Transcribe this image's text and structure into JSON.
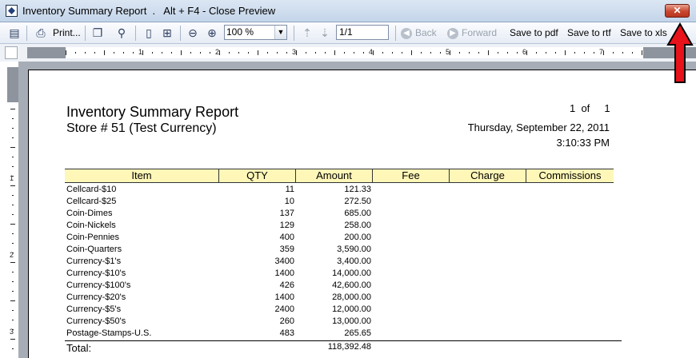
{
  "window": {
    "title": "Inventory Summary Report  .   Alt + F4 - Close Preview",
    "close_glyph": "✕"
  },
  "toolbar": {
    "print_label": "Print...",
    "zoom_value": "100 %",
    "page_value": "1/1",
    "back_label": "Back",
    "forward_label": "Forward",
    "save_pdf_label": "Save to pdf",
    "save_rtf_label": "Save to rtf",
    "save_xls_label": "Save to xls"
  },
  "ruler": {
    "numbers": [
      "1",
      "2",
      "3",
      "4",
      "5",
      "6",
      "7"
    ],
    "v_numbers": [
      "1",
      "2",
      "3"
    ]
  },
  "report": {
    "title": "Inventory Summary Report",
    "subtitle": "Store # 51 (Test Currency)",
    "page_of": "1  of     1",
    "date": "Thursday, September 22, 2011",
    "time": "3:10:33 PM",
    "columns": [
      "Item",
      "QTY",
      "Amount",
      "Fee",
      "Charge",
      "Commissions"
    ],
    "rows": [
      {
        "item": "Cellcard-$10",
        "qty": "11",
        "amount": "121.33"
      },
      {
        "item": "Cellcard-$25",
        "qty": "10",
        "amount": "272.50"
      },
      {
        "item": "Coin-Dimes",
        "qty": "137",
        "amount": "685.00"
      },
      {
        "item": "Coin-Nickels",
        "qty": "129",
        "amount": "258.00"
      },
      {
        "item": "Coin-Pennies",
        "qty": "400",
        "amount": "200.00"
      },
      {
        "item": "Coin-Quarters",
        "qty": "359",
        "amount": "3,590.00"
      },
      {
        "item": "Currency-$1's",
        "qty": "3400",
        "amount": "3,400.00"
      },
      {
        "item": "Currency-$10's",
        "qty": "1400",
        "amount": "14,000.00"
      },
      {
        "item": "Currency-$100's",
        "qty": "426",
        "amount": "42,600.00"
      },
      {
        "item": "Currency-$20's",
        "qty": "1400",
        "amount": "28,000.00"
      },
      {
        "item": "Currency-$5's",
        "qty": "2400",
        "amount": "12,000.00"
      },
      {
        "item": "Currency-$50's",
        "qty": "260",
        "amount": "13,000.00"
      },
      {
        "item": "Postage-Stamps-U.S.",
        "qty": "483",
        "amount": "265.65"
      }
    ],
    "total_label": "Total:",
    "total_amount": "118,392.48"
  },
  "colors": {
    "header_fill": "#fff7b8",
    "annotation_arrow": "#e8121b",
    "close_button": "#c8462e"
  }
}
